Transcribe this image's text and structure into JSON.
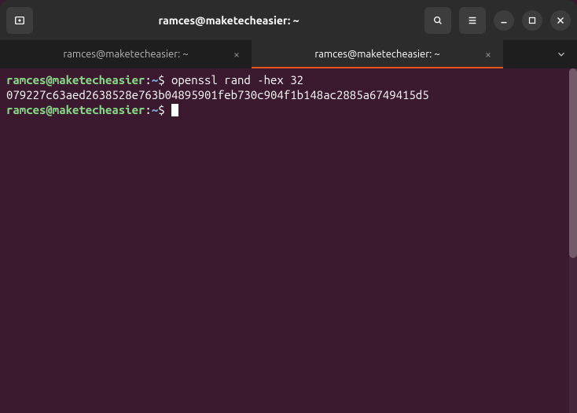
{
  "window": {
    "title": "ramces@maketecheasier: ~"
  },
  "tabs": [
    {
      "label": "ramces@maketecheasier: ~",
      "active": false
    },
    {
      "label": "ramces@maketecheasier: ~",
      "active": true
    }
  ],
  "terminal": {
    "prompt_user": "ramces@maketecheasier",
    "prompt_sep1": ":",
    "prompt_path": "~",
    "prompt_sep2": "$ ",
    "lines": [
      {
        "type": "prompt",
        "command": "openssl rand -hex 32"
      },
      {
        "type": "output",
        "text": "079227c63aed2638528e763b04895901feb730c904f1b148ac2885a6749415d5"
      },
      {
        "type": "prompt",
        "command": "",
        "cursor": true
      }
    ]
  },
  "scrollbar": {
    "thumb_height_pct": 55
  }
}
